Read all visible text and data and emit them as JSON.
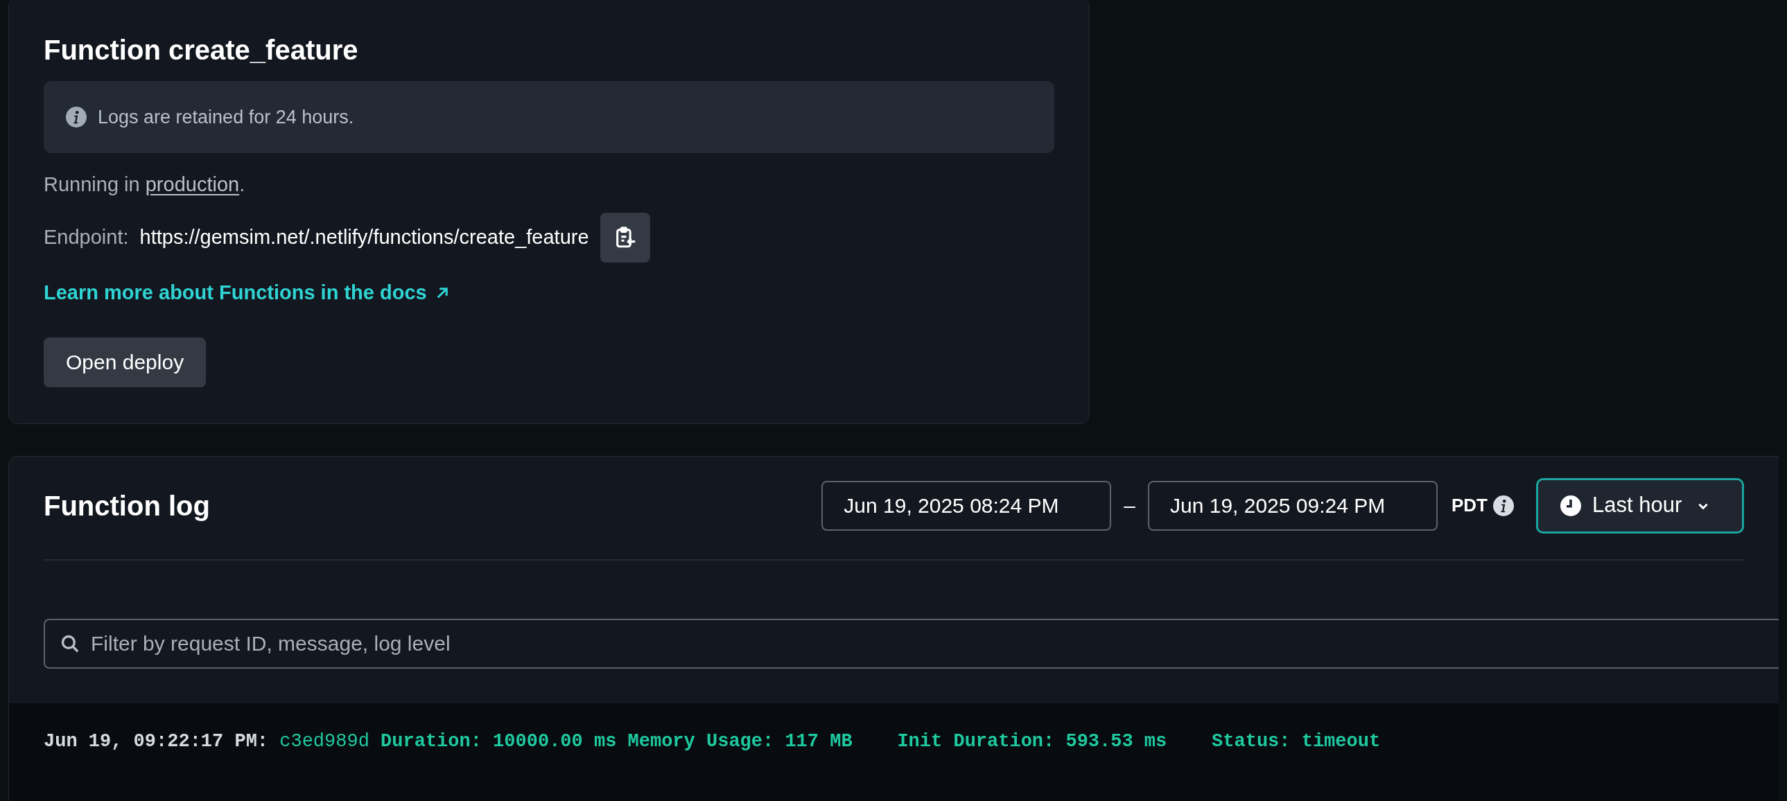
{
  "function_card": {
    "title": "Function create_feature",
    "notice": "Logs are retained for 24 hours.",
    "running_prefix": "Running in ",
    "running_link": "production",
    "running_suffix": ".",
    "endpoint_label": "Endpoint:",
    "endpoint_url": "https://gemsim.net/.netlify/functions/create_feature",
    "docs_link": "Learn more about Functions in the docs",
    "open_button": "Open deploy"
  },
  "log_card": {
    "title": "Function log",
    "date_from": "Jun 19, 2025 08:24 PM",
    "separator": "–",
    "date_to": "Jun 19, 2025 09:24 PM",
    "timezone": "PDT",
    "range_button": "Last hour",
    "filter": {
      "placeholder": "Filter by request ID, message, log level"
    },
    "entries": [
      {
        "timestamp": "Jun 19, 09:22:17 PM:",
        "request_id": "c3ed989d",
        "message": "Duration: 10000.00 ms Memory Usage: 117 MB    Init Duration: 593.53 ms    Status: timeout"
      }
    ]
  }
}
